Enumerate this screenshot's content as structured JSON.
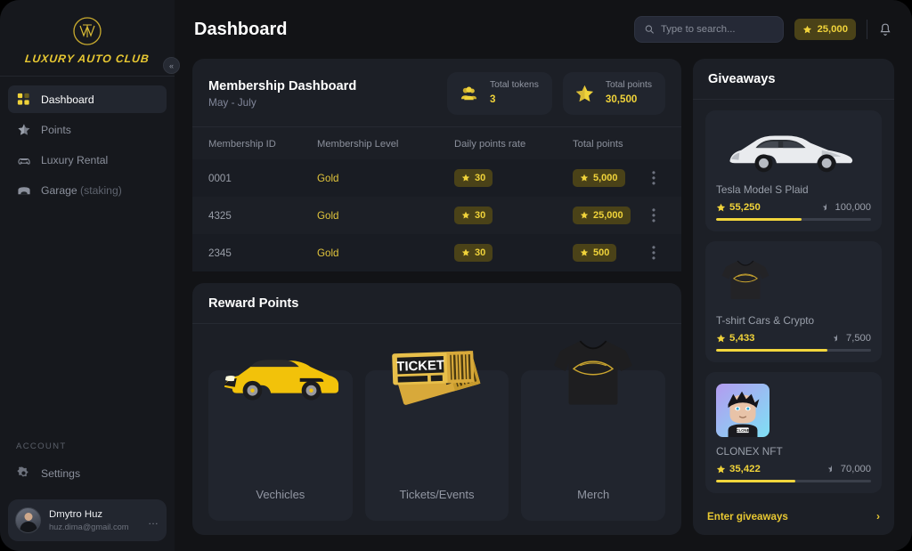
{
  "brand": {
    "name": "LUXURY AUTO CLUB",
    "logo_icon": "monogram-logo"
  },
  "sidebar": {
    "collapse_icon": "chevron-double-left-icon",
    "items": [
      {
        "label": "Dashboard",
        "icon": "grid-icon",
        "active": true
      },
      {
        "label": "Points",
        "icon": "half-star-icon",
        "active": false
      },
      {
        "label": "Luxury Rental",
        "icon": "car-icon",
        "active": false
      },
      {
        "label": "Garage",
        "sub": " (staking)",
        "icon": "garage-icon",
        "active": false
      }
    ],
    "account_heading": "ACCOUNT",
    "settings": {
      "label": "Settings",
      "icon": "gear-icon"
    },
    "user": {
      "name": "Dmytro Huz",
      "email": "huz.dima@gmail.com",
      "menu_icon": "ellipsis-icon",
      "avatar_icon": "avatar"
    }
  },
  "header": {
    "title": "Dashboard",
    "search": {
      "placeholder": "Type to search...",
      "value": "",
      "icon": "search-icon"
    },
    "points_badge": {
      "value": "25,000",
      "icon": "star-icon"
    },
    "bell_icon": "bell-icon"
  },
  "membership": {
    "title": "Membership Dashboard",
    "subtitle": "May - July",
    "stats": [
      {
        "label": "Total tokens",
        "value": "3",
        "icon": "people-icon"
      },
      {
        "label": "Total points",
        "value": "30,500",
        "icon": "star-icon"
      }
    ],
    "columns": [
      "Membership ID",
      "Membership Level",
      "Daily points rate",
      "Total points"
    ],
    "rows": [
      {
        "id": "0001",
        "level": "Gold",
        "rate": "30",
        "total": "5,000",
        "menu_icon": "more-vertical-icon"
      },
      {
        "id": "4325",
        "level": "Gold",
        "rate": "30",
        "total": "25,000",
        "menu_icon": "more-vertical-icon"
      },
      {
        "id": "2345",
        "level": "Gold",
        "rate": "30",
        "total": "500",
        "menu_icon": "more-vertical-icon"
      }
    ]
  },
  "rewards": {
    "title": "Reward Points",
    "cards": [
      {
        "label": "Vechicles",
        "icon": "lamborghini-image"
      },
      {
        "label": "Tickets/Events",
        "icon": "tickets-image"
      },
      {
        "label": "Merch",
        "icon": "tshirt-image"
      }
    ]
  },
  "giveaways": {
    "title": "Giveaways",
    "items": [
      {
        "name": "Tesla Model S Plaid",
        "current": "55,250",
        "target": "100,000",
        "progress": 55,
        "icon": "tesla-image"
      },
      {
        "name": "T-shirt Cars & Crypto",
        "current": "5,433",
        "target": "7,500",
        "progress": 72,
        "icon": "tshirt-image"
      },
      {
        "name": "CLONEX NFT",
        "current": "35,422",
        "target": "70,000",
        "progress": 51,
        "icon": "clonex-nft-image"
      }
    ],
    "footer_link": "Enter giveaways",
    "footer_icon": "chevron-right-icon"
  },
  "colors": {
    "accent": "#f0d33a",
    "panel": "#1c1f26",
    "page": "#121316",
    "sidebar": "#16181d"
  }
}
